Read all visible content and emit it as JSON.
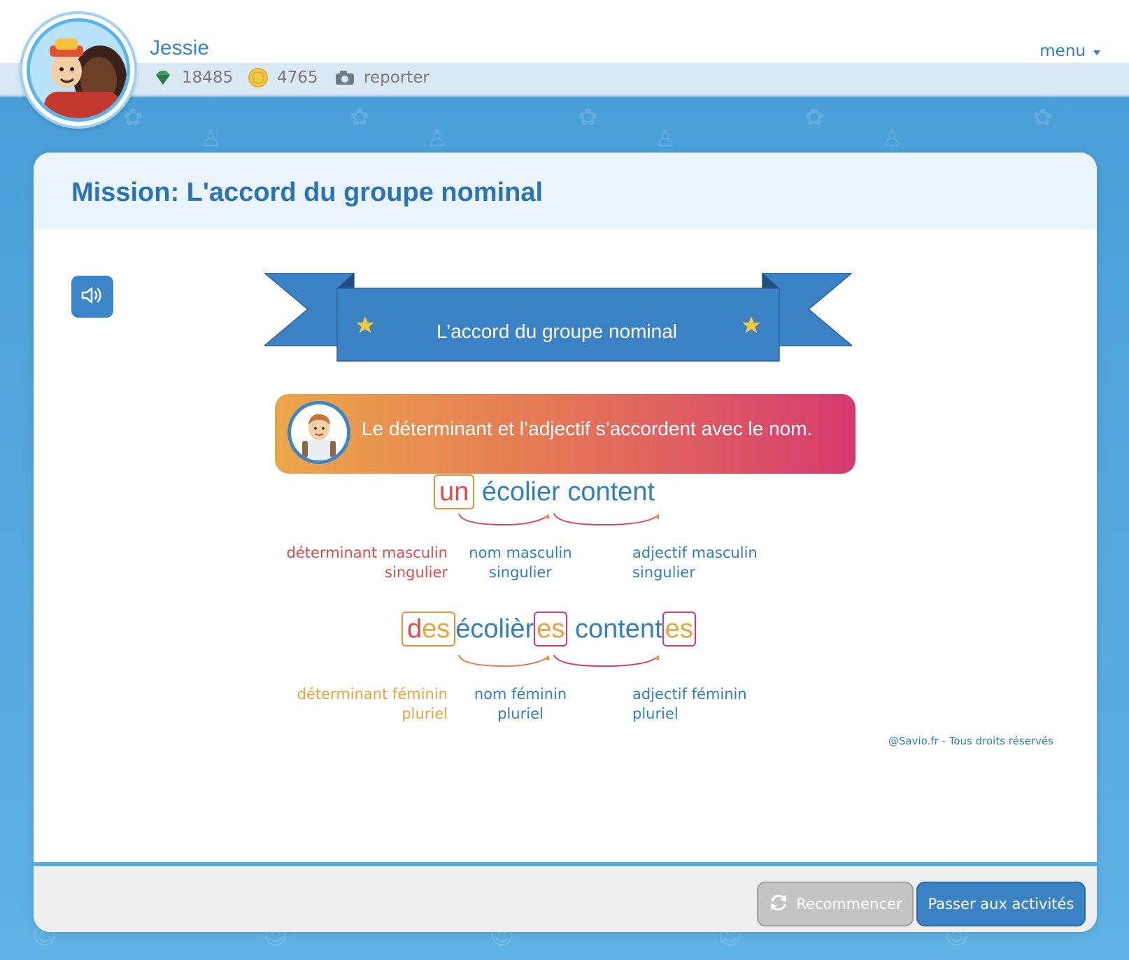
{
  "header": {
    "username": "Jessie",
    "gems": "18485",
    "coins": "4765",
    "report_label": "reporter",
    "menu_label": "menu"
  },
  "card": {
    "title": "Mission: L'accord du groupe nominal",
    "ribbon_title": "L’accord du groupe nominal",
    "rule_text": "Le déterminant et l’adjectif s’accordent avec le nom.",
    "example1": {
      "det": "un",
      "noun": "écolier",
      "adj": "content",
      "labels": {
        "det_line1": "déterminant masculin",
        "det_line2": "singulier",
        "noun_line1": "nom masculin",
        "noun_line2": "singulier",
        "adj_line1": "adjectif masculin",
        "adj_line2": "singulier"
      }
    },
    "example2": {
      "det_root": "d",
      "det_end": "es",
      "noun_root": "écoliè",
      "noun_r": "r",
      "noun_end": "es",
      "adj_root": "content",
      "adj_end": "es",
      "labels": {
        "det_line1": "déterminant féminin",
        "det_line2": "pluriel",
        "noun_line1": "nom féminin",
        "noun_line2": "pluriel",
        "adj_line1": "adjectif féminin",
        "adj_line2": "pluriel"
      }
    },
    "copyright": "@Savio.fr - Tous droits réservés"
  },
  "footer": {
    "restart_label": "Recommencer",
    "next_label": "Passer aux activités"
  },
  "colors": {
    "primary": "#2f7fc2",
    "red": "#e04a4a",
    "orange": "#eea23a",
    "pink": "#d63a70"
  },
  "icons": [
    "gem-icon",
    "coin-icon",
    "camera-icon",
    "chevron-down-icon",
    "speaker-icon",
    "star-icon",
    "refresh-icon"
  ]
}
